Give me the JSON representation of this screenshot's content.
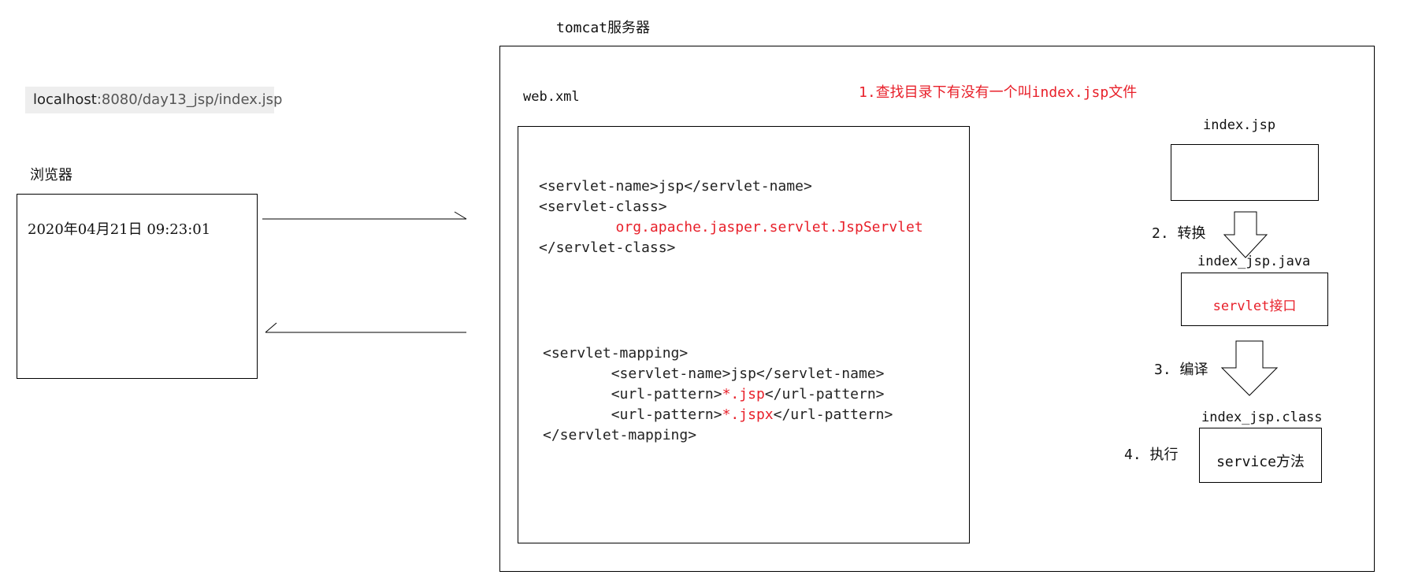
{
  "browser": {
    "url_host": "localhost",
    "url_path": ":8080/day13_jsp/index.jsp",
    "label": "浏览器",
    "content_text": "2020年04月21日 09:23:01"
  },
  "server": {
    "title": "tomcat服务器",
    "webxml_label": "web.xml",
    "step1": "1.查找目录下有没有一个叫index.jsp文件",
    "servlet": {
      "line1": "<servlet-name>jsp</servlet-name>",
      "line2": "<servlet-class>",
      "line3": "org.apache.jasper.servlet.JspServlet",
      "line4": "</servlet-class>"
    },
    "mapping": {
      "open": "<servlet-mapping>",
      "name": "<servlet-name>jsp</servlet-name>",
      "p1_open": "<url-pattern>",
      "p1_val": "*.jsp",
      "p1_close": "</url-pattern>",
      "p2_open": "<url-pattern>",
      "p2_val": "*.jspx",
      "p2_close": "</url-pattern>",
      "close": "</servlet-mapping>"
    },
    "flow": {
      "file1": "index.jsp",
      "step2": "2. 转换",
      "file2": "index_jsp.java",
      "box2_text": "servlet接口",
      "step3": "3. 编译",
      "file3": "index_jsp.class",
      "step4": "4. 执行",
      "box3_text": "service方法"
    }
  },
  "colors": {
    "accent_red": "#e8202a",
    "line": "#000000",
    "url_bar_bg": "#eeeeee"
  }
}
